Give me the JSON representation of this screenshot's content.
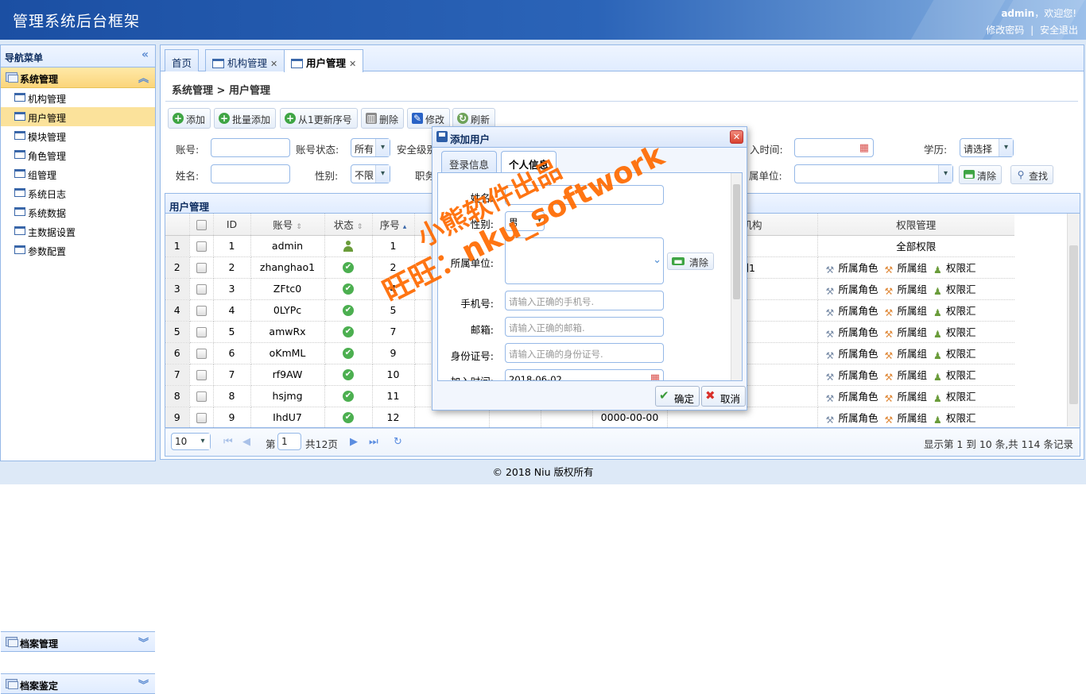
{
  "header": {
    "title": "管理系统后台框架",
    "user": "admin",
    "welcome_suffix": "，欢迎您!",
    "change_password": "修改密码",
    "separator": "|",
    "logout": "安全退出"
  },
  "sidebar": {
    "title": "导航菜单",
    "group1": "系统管理",
    "items": [
      "机构管理",
      "用户管理",
      "模块管理",
      "角色管理",
      "组管理",
      "系统日志",
      "系统数据",
      "主数据设置",
      "参数配置"
    ],
    "selected": "用户管理",
    "group2": "档案管理",
    "group3": "档案鉴定"
  },
  "tabs": [
    "首页",
    "机构管理",
    "用户管理"
  ],
  "breadcrumb": "系统管理 > 用户管理",
  "toolbar": {
    "add": "添加",
    "batch_add": "批量添加",
    "renumber": "从1更新序号",
    "delete": "删除",
    "edit": "修改",
    "refresh": "刷新"
  },
  "filters": {
    "account_label": "账号:",
    "account_status_label": "账号状态:",
    "account_status_value": "所有",
    "security_level_label": "安全级别",
    "join_time_label": "入时间:",
    "education_label": "学历:",
    "education_value": "请选择",
    "name_label": "姓名:",
    "gender_label": "性别:",
    "gender_value": "不限",
    "position_label": "职务",
    "unit_label": "属单位:",
    "clear": "清除",
    "search": "查找"
  },
  "grid": {
    "title": "用户管理",
    "headers": {
      "id": "ID",
      "account": "账号",
      "status": "状态",
      "order": "序号",
      "org": "所属机构",
      "perm": "权限管理"
    },
    "rows": [
      {
        "n": "1",
        "id": "1",
        "account": "admin",
        "status": "admin",
        "order": "1",
        "time": "",
        "org": "",
        "perm": "全部权限"
      },
      {
        "n": "2",
        "id": "2",
        "account": "zhanghao1",
        "status": "ok",
        "order": "2",
        "time": "",
        "org": "部门1",
        "perm": ""
      },
      {
        "n": "3",
        "id": "3",
        "account": "ZFtc0",
        "status": "ok",
        "order": "4",
        "time": "",
        "org": "",
        "perm": ""
      },
      {
        "n": "4",
        "id": "4",
        "account": "0LYPc",
        "status": "ok",
        "order": "5",
        "time": "",
        "org": "",
        "perm": ""
      },
      {
        "n": "5",
        "id": "5",
        "account": "amwRx",
        "status": "ok",
        "order": "7",
        "time": "",
        "org": "",
        "perm": ""
      },
      {
        "n": "6",
        "id": "6",
        "account": "oKmML",
        "status": "ok",
        "order": "9",
        "time": "",
        "org": "",
        "perm": ""
      },
      {
        "n": "7",
        "id": "7",
        "account": "rf9AW",
        "status": "ok",
        "order": "10",
        "time": "",
        "org": "",
        "perm": ""
      },
      {
        "n": "8",
        "id": "8",
        "account": "hsjmg",
        "status": "ok",
        "order": "11",
        "time": "",
        "org": "",
        "perm": ""
      },
      {
        "n": "9",
        "id": "9",
        "account": "IhdU7",
        "status": "ok",
        "order": "12",
        "time": "0000-00-00",
        "org": "",
        "perm": ""
      }
    ],
    "perm_role": "所属角色",
    "perm_group": "所属组",
    "perm_summary": "权限汇"
  },
  "pager": {
    "page_size": "10",
    "page_label": "第",
    "page_value": "1",
    "total_pages": "共12页",
    "summary": "显示第 1 到 10 条,共 114 条记录"
  },
  "footer": "© 2018 Niu 版权所有",
  "dialog": {
    "title": "添加用户",
    "tab_login": "登录信息",
    "tab_personal": "个人信息",
    "name_label": "姓名:",
    "gender_label": "性别:",
    "gender_value": "男",
    "unit_label": "所属单位:",
    "clear": "清除",
    "phone_label": "手机号:",
    "phone_placeholder": "请输入正确的手机号.",
    "email_label": "邮箱:",
    "email_placeholder": "请输入正确的邮箱.",
    "idcard_label": "身份证号:",
    "idcard_placeholder": "请输入正确的身份证号.",
    "join_label": "加入时间:",
    "join_value": "2018-06-02",
    "ok": "确定",
    "cancel": "取消"
  },
  "watermark": {
    "line1": "小熊软件出品",
    "line2": "旺旺：nku_softwork"
  }
}
